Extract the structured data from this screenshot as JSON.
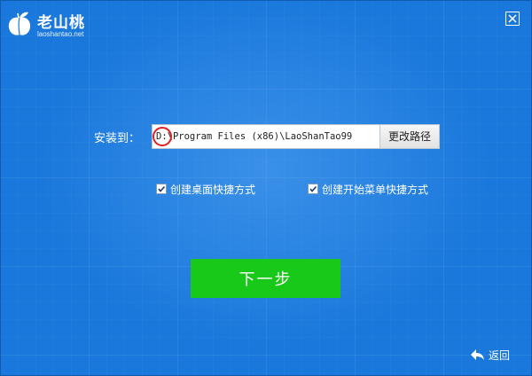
{
  "header": {
    "logo_title": "老山桃",
    "logo_url": "laoshantao.net",
    "logo_icon": "peach-logo-icon",
    "close_icon": "close-icon"
  },
  "install": {
    "label": "安装到：",
    "path_value": "D:\\Program Files (x86)\\LaoShanTao99",
    "change_path_label": "更改路径"
  },
  "options": {
    "desktop_shortcut_label": "创建桌面快捷方式",
    "desktop_shortcut_checked": true,
    "start_menu_shortcut_label": "创建开始菜单快捷方式",
    "start_menu_shortcut_checked": true
  },
  "actions": {
    "next_label": "下一步",
    "back_label": "返回",
    "back_icon": "back-arrow-icon"
  },
  "colors": {
    "background": "#1a78dc",
    "next_button": "#19c919",
    "annotation_circle": "#e02020"
  }
}
